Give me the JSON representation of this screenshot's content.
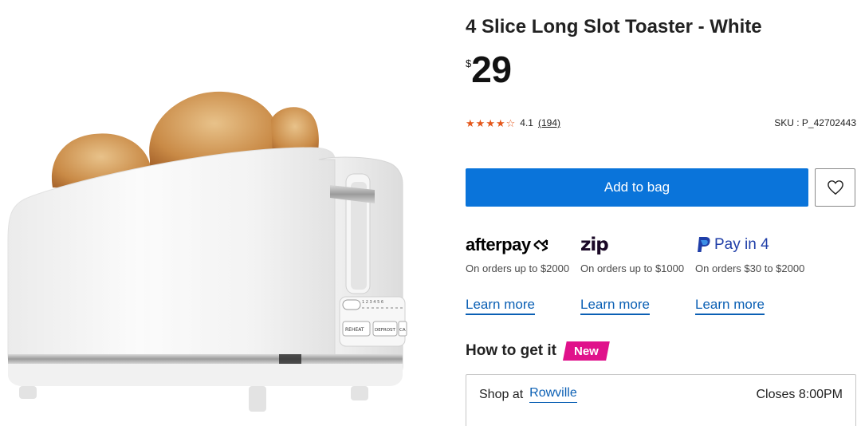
{
  "product": {
    "title": "4 Slice Long Slot Toaster - White",
    "currency_symbol": "$",
    "price": "29",
    "rating": {
      "stars_full": 4,
      "stars_total": 5,
      "value": "4.1",
      "reviews": "(194)"
    },
    "sku": "SKU : P_42702443",
    "image": {
      "toaster_labels": {
        "reheat": "REHEAT",
        "defrost": "DEFROST",
        "cancel": "CA",
        "levels": "1 2 3 4 5 6"
      }
    }
  },
  "actions": {
    "add_to_bag": "Add to bag",
    "wishlist_icon": "heart-icon"
  },
  "payments": [
    {
      "id": "afterpay",
      "logo_text": "afterpay",
      "description": "On orders up to $2000",
      "link": "Learn more"
    },
    {
      "id": "zip",
      "logo_text": "zip",
      "description": "On orders up to $1000",
      "link": "Learn more"
    },
    {
      "id": "paypal",
      "logo_text": "Pay in 4",
      "description": "On orders $30 to $2000",
      "link": "Learn more"
    }
  ],
  "fulfilment": {
    "title": "How to get it",
    "badge": "New",
    "shop_at_label": "Shop at",
    "store": "Rowville",
    "closes": "Closes 8:00PM"
  },
  "colors": {
    "primary_button": "#0a74da",
    "rating_star": "#e4571b",
    "new_badge": "#e0118b",
    "link": "#0a5fb4"
  }
}
